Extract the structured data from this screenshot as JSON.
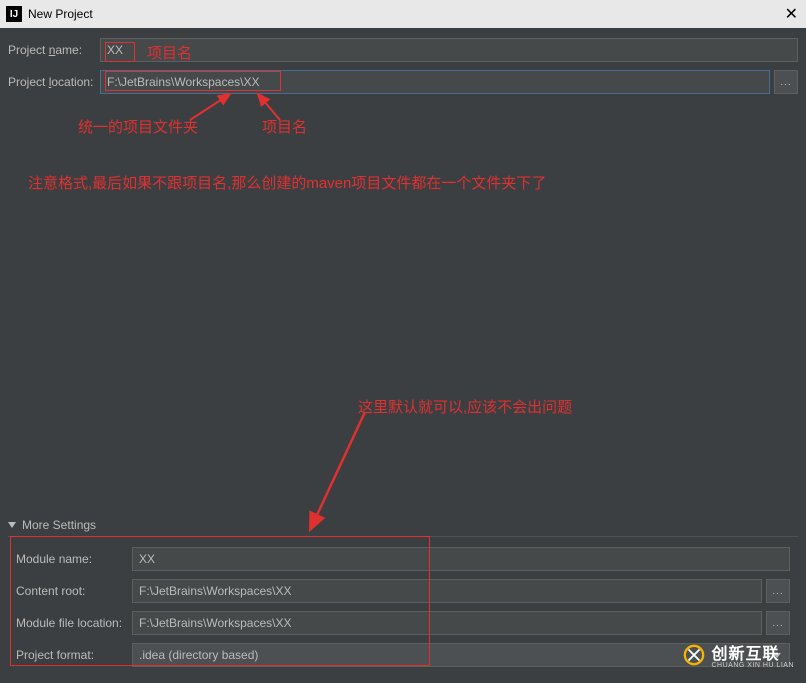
{
  "window": {
    "title": "New Project",
    "icon_letter": "IJ"
  },
  "fields": {
    "project_name_label": "Project name:",
    "project_name_value": "XX",
    "project_location_label": "Project location:",
    "project_location_value": "F:\\JetBrains\\Workspaces\\XX",
    "browse_text": "..."
  },
  "annotations": {
    "proj_name_note": "项目名",
    "unified_folder": "统一的项目文件夹",
    "proj_name_note2": "项目名",
    "format_warning": "注意格式,最后如果不跟项目名,那么创建的maven项目文件都在一个文件夹下了",
    "default_ok": "这里默认就可以,应该不会出问题"
  },
  "more_settings": {
    "header": "More Settings",
    "module_name_label": "Module name:",
    "module_name_value": "XX",
    "content_root_label": "Content root:",
    "content_root_value": "F:\\JetBrains\\Workspaces\\XX",
    "module_file_location_label": "Module file location:",
    "module_file_location_value": "F:\\JetBrains\\Workspaces\\XX",
    "project_format_label": "Project format:",
    "project_format_value": ".idea (directory based)"
  },
  "watermark": {
    "main": "创新互联",
    "sub": "CHUANG XIN HU LIAN"
  }
}
